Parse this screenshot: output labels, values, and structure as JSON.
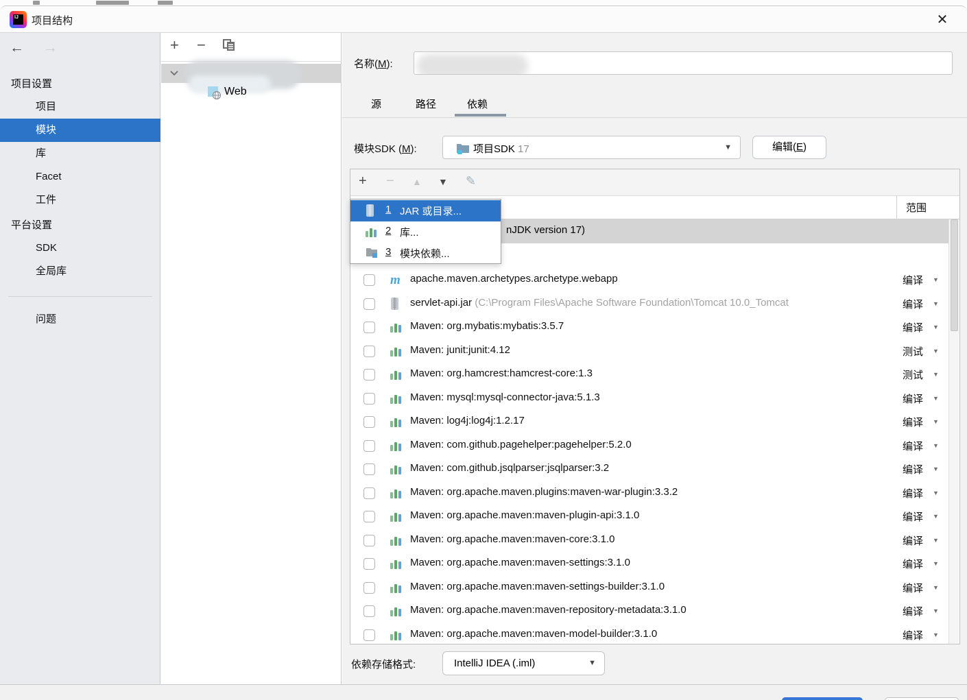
{
  "window": {
    "title": "项目结构",
    "close_glyph": "✕"
  },
  "sidebar": {
    "back_glyph": "←",
    "forward_glyph": "→",
    "group_project_settings": "项目设置",
    "item_project": "项目",
    "item_modules": "模块",
    "item_libraries": "库",
    "item_facet": "Facet",
    "item_artifacts": "工件",
    "group_platform_settings": "平台设置",
    "item_sdk": "SDK",
    "item_global_libraries": "全局库",
    "item_problems": "问题",
    "selected_item": "模块"
  },
  "tree": {
    "add_glyph": "+",
    "remove_glyph": "−",
    "module_child_label": "Web"
  },
  "main": {
    "name_label_pre": "名称(",
    "name_label_mn": "M",
    "name_label_post": "):",
    "tab_sources": "源",
    "tab_paths": "路径",
    "tab_dependencies": "依赖",
    "active_tab": "依赖",
    "sdk_label_pre": "模块SDK (",
    "sdk_label_mn": "M",
    "sdk_label_post": "):",
    "sdk_value": "项目SDK",
    "sdk_version": "17",
    "edit_button_pre": "编辑(",
    "edit_button_mn": "E",
    "edit_button_post": ")",
    "toolbar_add": "+",
    "toolbar_remove": "−",
    "toolbar_up": "▲",
    "toolbar_down": "▼",
    "toolbar_edit": "✎",
    "scope_header": "范围",
    "selected_row_visible_text": "nJDK version 17)",
    "storage_label": "依赖存储格式:",
    "storage_value": "IntelliJ IDEA (.iml)"
  },
  "popup": {
    "items": [
      {
        "num": "1",
        "label": "JAR 或目录...",
        "icon": "jar-icon",
        "selected": true
      },
      {
        "num": "2",
        "label": "库...",
        "icon": "library-icon",
        "selected": false
      },
      {
        "num": "3",
        "label": "模块依赖...",
        "icon": "module-icon",
        "selected": false
      }
    ]
  },
  "dependencies": [
    {
      "icon": "maven",
      "name": "apache.maven.archetypes.archetype.webapp",
      "path": "",
      "scope": "编译"
    },
    {
      "icon": "jar",
      "name": "servlet-api.jar",
      "path": "(C:\\Program Files\\Apache Software Foundation\\Tomcat 10.0_Tomcat",
      "scope": "编译"
    },
    {
      "icon": "library",
      "name": "Maven: org.mybatis:mybatis:3.5.7",
      "path": "",
      "scope": "编译"
    },
    {
      "icon": "library",
      "name": "Maven: junit:junit:4.12",
      "path": "",
      "scope": "测试"
    },
    {
      "icon": "library",
      "name": "Maven: org.hamcrest:hamcrest-core:1.3",
      "path": "",
      "scope": "测试"
    },
    {
      "icon": "library",
      "name": "Maven: mysql:mysql-connector-java:5.1.3",
      "path": "",
      "scope": "编译"
    },
    {
      "icon": "library",
      "name": "Maven: log4j:log4j:1.2.17",
      "path": "",
      "scope": "编译"
    },
    {
      "icon": "library",
      "name": "Maven: com.github.pagehelper:pagehelper:5.2.0",
      "path": "",
      "scope": "编译"
    },
    {
      "icon": "library",
      "name": "Maven: com.github.jsqlparser:jsqlparser:3.2",
      "path": "",
      "scope": "编译"
    },
    {
      "icon": "library",
      "name": "Maven: org.apache.maven.plugins:maven-war-plugin:3.3.2",
      "path": "",
      "scope": "编译"
    },
    {
      "icon": "library",
      "name": "Maven: org.apache.maven:maven-plugin-api:3.1.0",
      "path": "",
      "scope": "编译"
    },
    {
      "icon": "library",
      "name": "Maven: org.apache.maven:maven-core:3.1.0",
      "path": "",
      "scope": "编译"
    },
    {
      "icon": "library",
      "name": "Maven: org.apache.maven:maven-settings:3.1.0",
      "path": "",
      "scope": "编译"
    },
    {
      "icon": "library",
      "name": "Maven: org.apache.maven:maven-settings-builder:3.1.0",
      "path": "",
      "scope": "编译"
    },
    {
      "icon": "library",
      "name": "Maven: org.apache.maven:maven-repository-metadata:3.1.0",
      "path": "",
      "scope": "编译"
    },
    {
      "icon": "library",
      "name": "Maven: org.apache.maven:maven-model-builder:3.1.0",
      "path": "",
      "scope": "编译"
    }
  ],
  "colors": {
    "selection_blue": "#2b74c8",
    "row_selected_gray": "#d4d4d4",
    "sidebar_bg": "#e9ebee",
    "main_bg": "#f2f2f3",
    "maven_blue": "#49a6dc",
    "library_green": "#59a869",
    "library_blue": "#4a92c8"
  }
}
